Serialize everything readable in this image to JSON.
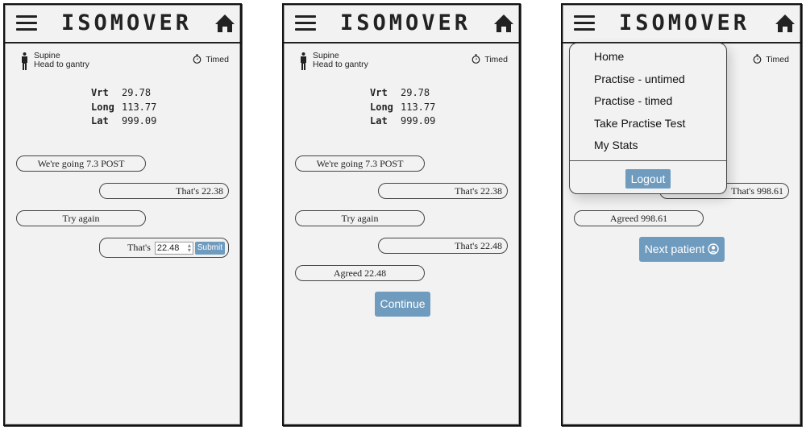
{
  "app": {
    "title": "ISOMOVER"
  },
  "colors": {
    "accent": "#6f9bbf",
    "background": "#f2f2f2"
  },
  "screens": [
    {
      "patient": {
        "position": "Supine",
        "orientation": "Head to gantry"
      },
      "mode": "Timed",
      "coords": [
        {
          "label": "Vrt",
          "value": "29.78"
        },
        {
          "label": "Long",
          "value": "113.77"
        },
        {
          "label": "Lat",
          "value": "999.09"
        }
      ],
      "messages": [
        {
          "side": "left",
          "text": "We're going 7.3 POST"
        },
        {
          "side": "right",
          "text": "That's 22.38"
        },
        {
          "side": "left",
          "text": "Try again"
        }
      ],
      "input_row": {
        "prefix": "That's",
        "value": "22.48",
        "submit_label": "Submit"
      }
    },
    {
      "patient": {
        "position": "Supine",
        "orientation": "Head to gantry"
      },
      "mode": "Timed",
      "coords": [
        {
          "label": "Vrt",
          "value": "29.78"
        },
        {
          "label": "Long",
          "value": "113.77"
        },
        {
          "label": "Lat",
          "value": "999.09"
        }
      ],
      "messages": [
        {
          "side": "left",
          "text": "We're going 7.3 POST"
        },
        {
          "side": "right",
          "text": "That's 22.38"
        },
        {
          "side": "left",
          "text": "Try again"
        },
        {
          "side": "right",
          "text": "That's 22.48"
        },
        {
          "side": "left",
          "text": "Agreed 22.48"
        }
      ],
      "action_button": "Continue"
    },
    {
      "mode": "Timed",
      "messages": [
        {
          "side": "right",
          "text": "That's 998.61"
        },
        {
          "side": "left",
          "text": "Agreed 998.61"
        }
      ],
      "action_button": "Next patient",
      "menu": {
        "items": [
          "Home",
          "Practise - untimed",
          "Practise - timed",
          "Take Practise Test",
          "My Stats"
        ],
        "logout_label": "Logout"
      }
    }
  ]
}
